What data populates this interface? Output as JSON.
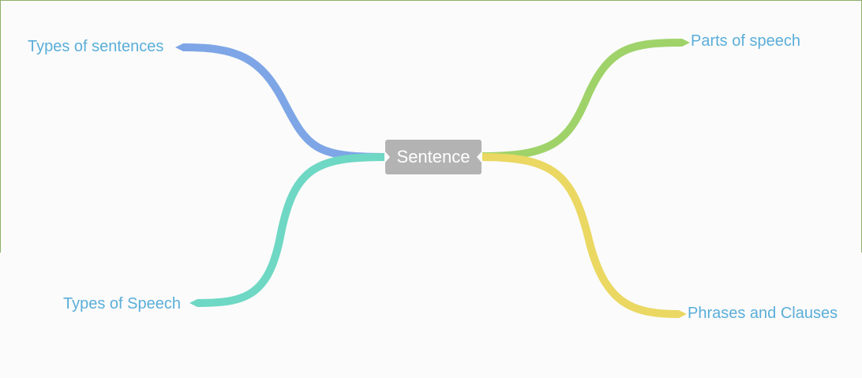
{
  "central": {
    "label": "Sentence"
  },
  "branches": [
    {
      "id": "types-of-sentences",
      "label": "Types of sentences",
      "color": "#7ea6e6"
    },
    {
      "id": "parts-of-speech",
      "label": "Parts of speech",
      "color": "#9fd36a"
    },
    {
      "id": "types-of-speech",
      "label": "Types of Speech",
      "color": "#6ed8c4"
    },
    {
      "id": "phrases-and-clauses",
      "label": "Phrases and Clauses",
      "color": "#ead862"
    }
  ],
  "colors": {
    "background": "#fbfbfb",
    "frame": "#8fad6a",
    "label_text": "#5aaed9",
    "central_fill": "#b3b3b3",
    "central_text": "#ffffff"
  }
}
